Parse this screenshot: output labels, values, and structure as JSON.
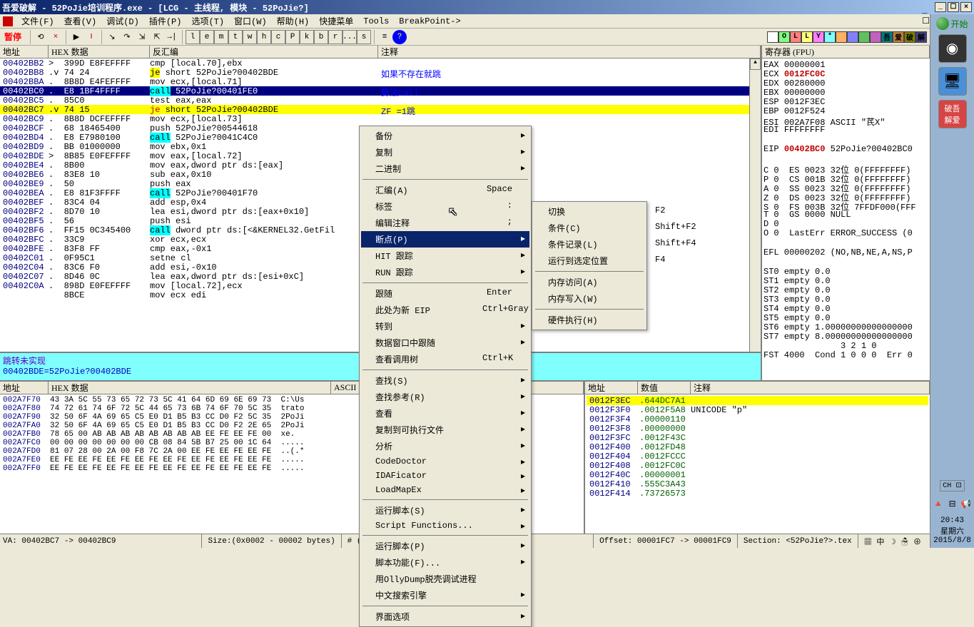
{
  "title": "吾爱破解 - 52PoJie培训程序.exe - [LCG - 主线程, 模块 - 52PoJie?]",
  "menu": {
    "file": "文件(F)",
    "view": "查看(V)",
    "debug": "调试(D)",
    "plugins": "插件(P)",
    "Immlib": "选项(T)",
    "window": "窗口(W)",
    "help": "帮助(H)",
    "shortcut": "快捷菜单",
    "tools": "Tools",
    "breakpoint": "BreakPoint->"
  },
  "toolbar": {
    "pause": "暂停",
    "letters": [
      "l",
      "e",
      "m",
      "t",
      "w",
      "h",
      "c",
      "P",
      "k",
      "b",
      "r",
      "...",
      "s"
    ],
    "colored": [
      {
        "bg": "#fff",
        "t": ""
      },
      {
        "bg": "#80ff80",
        "t": "O"
      },
      {
        "bg": "#ff8080",
        "t": "L"
      },
      {
        "bg": "#ffff80",
        "t": "L"
      },
      {
        "bg": "#ff80ff",
        "t": "Y"
      },
      {
        "bg": "#80ffff",
        "t": "*"
      },
      {
        "bg": "#ffb060",
        "t": ""
      },
      {
        "bg": "#8080ff",
        "t": ""
      },
      {
        "bg": "#60c060",
        "t": ""
      },
      {
        "bg": "#c060c0",
        "t": ""
      },
      {
        "bg": "#008080",
        "t": "吾"
      },
      {
        "bg": "#c08040",
        "t": "爱"
      },
      {
        "bg": "#808000",
        "t": "破"
      },
      {
        "bg": "#404080",
        "t": "解"
      }
    ]
  },
  "cpu_headers": {
    "addr": "地址",
    "hex": "HEX 数据",
    "dis": "反汇编",
    "cmt": "注释"
  },
  "cpu_rows": [
    {
      "addr": "00402BB2",
      "hex": ">  399D E8FEFFFF",
      "dis": "cmp [local.70],ebx"
    },
    {
      "addr": "00402BB8",
      "hex": ".v 74 24",
      "dis": "<span class='jmp'>je</span> short 52PoJie?00402BDE",
      "cmt": "如果不存在就跳"
    },
    {
      "addr": "00402BBA",
      "hex": ".  8B8D E4FEFFFF",
      "dis": "mov ecx,[local.71]"
    },
    {
      "addr": "00402BC0",
      "hex": ".  E8 1BF4FFFF",
      "dis": "<span class='call'>call</span> 52PoJie?00401FE0",
      "cmt": "算法Call",
      "sel": true
    },
    {
      "addr": "00402BC5",
      "hex": ".  85C0",
      "dis": "test eax,eax"
    },
    {
      "addr": "00402BC7",
      "hex": ".v 74 15",
      "dis": "<span class='jmp'>je</span> short 52PoJie?00402BDE",
      "cmt": "ZF =1跳",
      "hl": true
    },
    {
      "addr": "00402BC9",
      "hex": ".  8B8D DCFEFFFF",
      "dis": "mov ecx,[local.73]"
    },
    {
      "addr": "00402BCF",
      "hex": ".  68 18465400",
      "dis": "push 52PoJie?00544618"
    },
    {
      "addr": "00402BD4",
      "hex": ".  E8 E7980100",
      "dis": "<span class='call'>call</span> 52PoJie?0041C4C0"
    },
    {
      "addr": "00402BD9",
      "hex": ".  BB 01000000",
      "dis": "mov ebx,0x1"
    },
    {
      "addr": "00402BDE",
      "hex": ">  8B85 E0FEFFFF",
      "dis": "mov eax,[local.72]"
    },
    {
      "addr": "00402BE4",
      "hex": ".  8B00",
      "dis": "mov eax,dword ptr ds:[eax]"
    },
    {
      "addr": "00402BE6",
      "hex": ".  83E8 10",
      "dis": "sub eax,0x10"
    },
    {
      "addr": "00402BE9",
      "hex": ".  50",
      "dis": "push eax"
    },
    {
      "addr": "00402BEA",
      "hex": ".  E8 81F3FFFF",
      "dis": "<span class='call'>call</span> 52PoJie?00401F70"
    },
    {
      "addr": "00402BEF",
      "hex": ".  83C4 04",
      "dis": "add esp,0x4"
    },
    {
      "addr": "00402BF2",
      "hex": ".  8D70 10",
      "dis": "lea esi,dword ptr ds:[eax+0x10]"
    },
    {
      "addr": "00402BF5",
      "hex": ".  56",
      "dis": "push esi"
    },
    {
      "addr": "00402BF6",
      "hex": ".  FF15 0C345400",
      "dis": "<span class='call'>call</span> dword ptr ds:[<&KERNEL32.GetFil"
    },
    {
      "addr": "00402BFC",
      "hex": ".  33C9",
      "dis": "xor ecx,ecx"
    },
    {
      "addr": "00402BFE",
      "hex": ".  83F8 FF",
      "dis": "cmp eax,-0x1"
    },
    {
      "addr": "00402C01",
      "hex": ".  0F95C1",
      "dis": "setne cl"
    },
    {
      "addr": "00402C04",
      "hex": ".  83C6 F0",
      "dis": "add esi,-0x10"
    },
    {
      "addr": "00402C07",
      "hex": ".  8D46 0C",
      "dis": "lea eax,dword ptr ds:[esi+0xC]"
    },
    {
      "addr": "00402C0A",
      "hex": ".  898D E0FEFFFF",
      "dis": "mov [local.72],ecx"
    },
    {
      "addr": "",
      "hex": "   8BCE",
      "dis": "mov ecx edi"
    }
  ],
  "info_pane": {
    "l1": "跳转未实现",
    "l2": "00402BDE=52PoJie?00402BDE"
  },
  "reg_header": "寄存器 (FPU)",
  "registers": [
    {
      "name": "EAX",
      "val": "00000001"
    },
    {
      "name": "ECX",
      "val": "0012FC0C",
      "changed": true
    },
    {
      "name": "EDX",
      "val": "00280000"
    },
    {
      "name": "EBX",
      "val": "00000000"
    },
    {
      "name": "ESP",
      "val": "0012F3EC"
    },
    {
      "name": "EBP",
      "val": "0012F524"
    },
    {
      "name": "ESI",
      "val": "002A7F08 ASCII \"芪X\""
    },
    {
      "name": "EDI",
      "val": "FFFFFFFF"
    }
  ],
  "eip": {
    "name": "EIP",
    "val": "00402BC0",
    "extra": " 52PoJie?00402BC0"
  },
  "flags": [
    "C 0  ES 0023 32位 0(FFFFFFFF)",
    "P 0  CS 001B 32位 0(FFFFFFFF)",
    "A 0  SS 0023 32位 0(FFFFFFFF)",
    "Z 0  DS 0023 32位 0(FFFFFFFF)",
    "S 0  FS 003B 32位 7FFDF000(FFF",
    "T 0  GS 0000 NULL",
    "D 0",
    "O 0  LastErr ERROR_SUCCESS (0"
  ],
  "efl": "EFL 00000202 (NO,NB,NE,A,NS,P",
  "fpu": [
    "ST0 empty 0.0",
    "ST1 empty 0.0",
    "ST2 empty 0.0",
    "ST3 empty 0.0",
    "ST4 empty 0.0",
    "ST5 empty 0.0",
    "ST6 empty 1.00000000000000000",
    "ST7 empty 8.00000000000000000",
    "               3 2 1 0",
    "FST 4000  Cond 1 0 0 0  Err 0"
  ],
  "dump_headers": {
    "addr": "地址",
    "hex": "HEX 数据",
    "ascii": "ASCII"
  },
  "dump_rows": [
    "002A7F70  43 3A 5C 55 73 65 72 73 5C 41 64 6D 69 6E 69 73  C:\\Us",
    "002A7F80  74 72 61 74 6F 72 5C 44 65 73 6B 74 6F 70 5C 35  trato",
    "002A7F90  32 50 6F 4A 69 65 C5 E0 D1 B5 B3 CC D0 F2 5C 35  2PoJi",
    "002A7FA0  32 50 6F 4A 69 65 C5 E0 D1 B5 B3 CC D0 F2 2E 65  2PoJi",
    "002A7FB0  78 65 00 AB AB AB AB AB AB AB AB EE FE EE FE 00  xe.",
    "002A7FC0  00 00 00 00 00 00 00 CB 08 84 5B B7 25 00 1C 64  .....",
    "002A7FD0  81 07 28 00 2A 00 F8 7C 2A 00 EE FE EE FE EE FE  ..(.*",
    "002A7FE0  EE FE EE FE EE FE EE FE EE FE EE FE EE FE EE FE  .....",
    "002A7FF0  EE FE EE FE EE FE EE FE EE FE EE FE EE FE EE FE  ....."
  ],
  "stack_headers": {
    "addr": "地址",
    "val": "数值",
    "cmt": "注释"
  },
  "stack_rows": [
    {
      "a": "0012F3EC",
      "v": "644DC7A1",
      "hl": true
    },
    {
      "a": "0012F3F0",
      "v": "0012F5A8",
      "c": "UNICODE \"p\""
    },
    {
      "a": "0012F3F4",
      "v": "00000110"
    },
    {
      "a": "0012F3F8",
      "v": "00000000"
    },
    {
      "a": "0012F3FC",
      "v": "0012F43C"
    },
    {
      "a": "0012F400",
      "v": "0012FD48"
    },
    {
      "a": "0012F404",
      "v": "0012FCCC"
    },
    {
      "a": "0012F408",
      "v": "0012FC0C"
    },
    {
      "a": "0012F40C",
      "v": "00000001"
    },
    {
      "a": "0012F410",
      "v": "555C3A43"
    },
    {
      "a": "0012F414",
      "v": "73726573"
    }
  ],
  "context_main": [
    {
      "label": "备份",
      "arrow": true
    },
    {
      "label": "复制",
      "arrow": true
    },
    {
      "label": "二进制",
      "arrow": true
    },
    {
      "sep": true
    },
    {
      "label": "汇编(A)",
      "shortcut": "Space"
    },
    {
      "label": "标签",
      "shortcut": ":"
    },
    {
      "label": "编辑注释",
      "shortcut": ";"
    },
    {
      "label": "断点(P)",
      "arrow": true,
      "hl": true
    },
    {
      "label": "HIT 跟踪",
      "arrow": true
    },
    {
      "label": "RUN 跟踪",
      "arrow": true
    },
    {
      "sep": true
    },
    {
      "label": "跟随",
      "shortcut": "Enter"
    },
    {
      "label": "此处为新 EIP",
      "shortcut": "Ctrl+Gray *"
    },
    {
      "label": "转到",
      "arrow": true
    },
    {
      "label": "数据窗口中跟随",
      "arrow": true
    },
    {
      "label": "查看调用树",
      "shortcut": "Ctrl+K"
    },
    {
      "sep": true
    },
    {
      "label": "查找(S)",
      "arrow": true
    },
    {
      "label": "查找参考(R)",
      "arrow": true
    },
    {
      "label": "查看",
      "arrow": true
    },
    {
      "label": "复制到可执行文件",
      "arrow": true
    },
    {
      "label": "分析",
      "arrow": true
    },
    {
      "label": "CodeDoctor",
      "arrow": true
    },
    {
      "label": "IDAFicator",
      "arrow": true
    },
    {
      "label": "LoadMapEx",
      "arrow": true
    },
    {
      "sep": true
    },
    {
      "label": "运行脚本(S)",
      "arrow": true
    },
    {
      "label": "Script Functions...",
      "arrow": true
    },
    {
      "sep": true
    },
    {
      "label": "运行脚本(P)",
      "arrow": true
    },
    {
      "label": "脚本功能(F)...",
      "arrow": true
    },
    {
      "label": "用OllyDump脱壳调试进程"
    },
    {
      "label": "中文搜索引擎",
      "arrow": true
    },
    {
      "sep": true
    },
    {
      "label": "界面选项",
      "arrow": true
    }
  ],
  "context_sub": [
    {
      "label": "切换",
      "shortcut": "F2"
    },
    {
      "label": "条件(C)",
      "shortcut": "Shift+F2"
    },
    {
      "label": "条件记录(L)",
      "shortcut": "Shift+F4"
    },
    {
      "label": "运行到选定位置",
      "shortcut": "F4"
    },
    {
      "sep": true
    },
    {
      "label": "内存访问(A)"
    },
    {
      "label": "内存写入(W)"
    },
    {
      "sep": true
    },
    {
      "label": "硬件执行(H)"
    }
  ],
  "status": {
    "va": "VA: 00402BC7 -> 00402BC9",
    "size": "Size:(0x0002 - 00002 bytes)",
    "count": "# (0x0000 - 000001 dwords)",
    "offset": "Offset: 00001FC7 -> 00001FC9",
    "section": "Section: <52PoJie?>.tex"
  },
  "sidebar": {
    "start": "开始",
    "clock_time": "20:43",
    "clock_day": "星期六",
    "clock_date": "2015/8/8",
    "ch": "CH"
  }
}
